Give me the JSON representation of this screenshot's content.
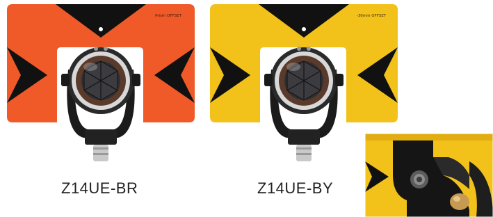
{
  "products": [
    {
      "caption": "Z14UE-BR",
      "plate_color": "#ef5a28",
      "offset_label": "Prism OFFSET"
    },
    {
      "caption": "Z14UE-BY",
      "plate_color": "#f2c21b",
      "offset_label": "-30mm OFFSET"
    }
  ],
  "colors": {
    "mark": "#111111",
    "background": "#ffffff"
  },
  "inset": {
    "plate_color": "#f2c21b"
  }
}
